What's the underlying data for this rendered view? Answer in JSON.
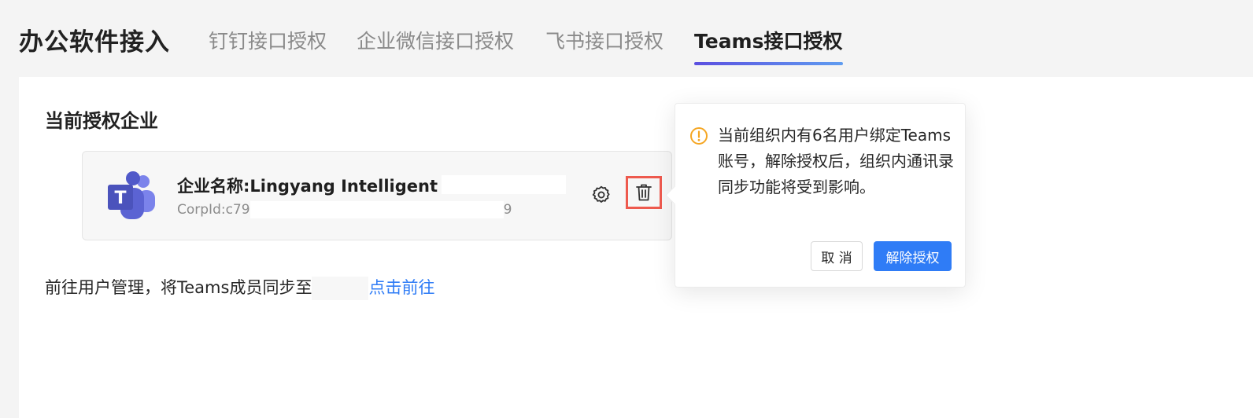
{
  "page": {
    "title": "办公软件接入"
  },
  "tabs": [
    {
      "label": "钉钉接口授权",
      "active": false
    },
    {
      "label": "企业微信接口授权",
      "active": false
    },
    {
      "label": "飞书接口授权",
      "active": false
    },
    {
      "label": "Teams接口授权",
      "active": true
    }
  ],
  "section": {
    "title": "当前授权企业"
  },
  "company": {
    "name": "企业名称:Lingyang Intelligent Tec",
    "corp_id_prefix": "CorpId:c79",
    "corp_id_suffix": "9",
    "logo_letter": "T"
  },
  "sync": {
    "text": "前往用户管理，将Teams成员同步至",
    "link": "点击前往"
  },
  "popover": {
    "message": "当前组织内有6名用户绑定Teams账号，解除授权后，组织内通讯录同步功能将受到影响。",
    "cancel_label": "取 消",
    "confirm_label": "解除授权"
  },
  "colors": {
    "primary": "#2f7cf6",
    "warning": "#f5a623",
    "highlight_border": "#ee5a4e",
    "teams_purple": "#5059c9"
  },
  "icons": {
    "teams_logo": "teams-logo-icon",
    "settings": "gear-icon",
    "delete": "trash-icon",
    "warning": "warning-circle-icon"
  }
}
